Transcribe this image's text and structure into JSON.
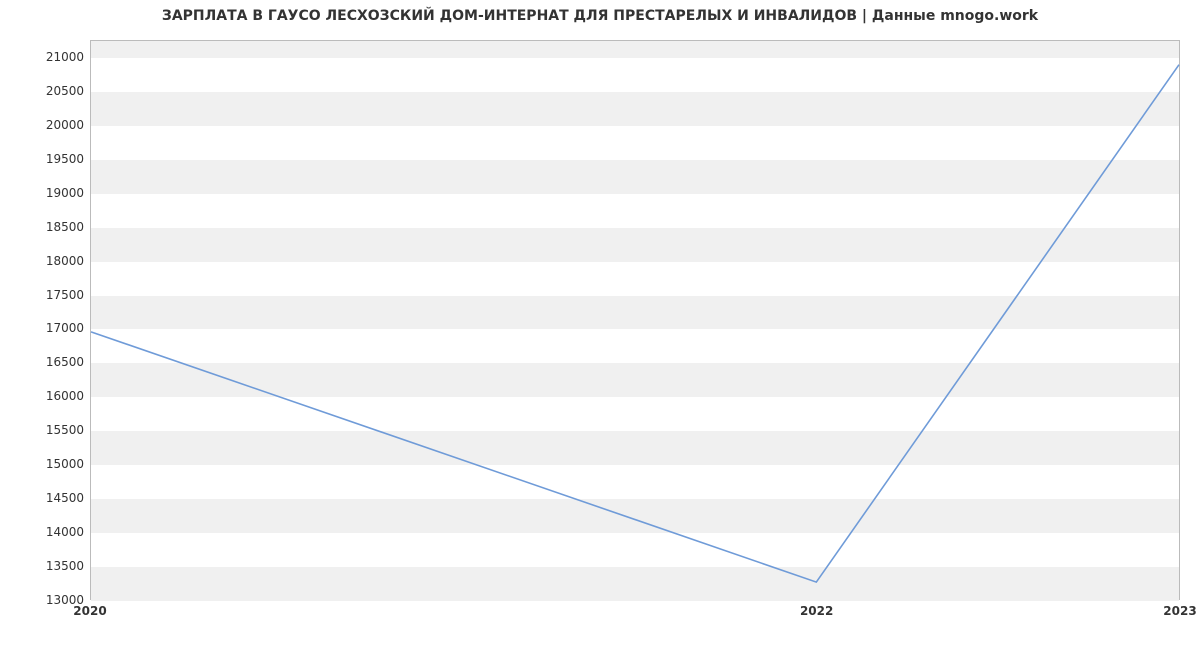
{
  "chart_data": {
    "type": "line",
    "title": "ЗАРПЛАТА В ГАУСО ЛЕСХОЗСКИЙ ДОМ-ИНТЕРНАТ ДЛЯ ПРЕСТАРЕЛЫХ И ИНВАЛИДОВ | Данные mnogo.work",
    "x": [
      2020,
      2022,
      2023
    ],
    "values": [
      16950,
      13250,
      20900
    ],
    "xlabel": "",
    "ylabel": "",
    "ylim": [
      13000,
      21250
    ],
    "yticks": [
      13000,
      13500,
      14000,
      14500,
      15000,
      15500,
      16000,
      16500,
      17000,
      17500,
      18000,
      18500,
      19000,
      19500,
      20000,
      20500,
      21000
    ],
    "xticks": [
      2020,
      2022,
      2023
    ],
    "line_color": "#6f9bd8"
  }
}
